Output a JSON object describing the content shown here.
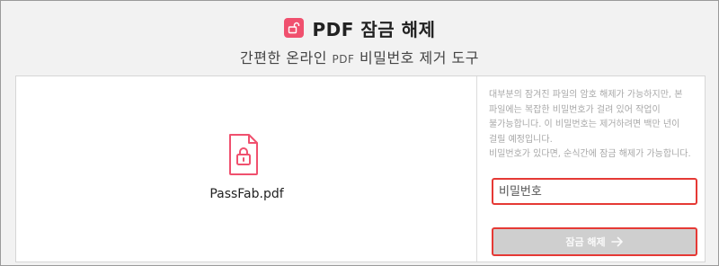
{
  "header": {
    "title": "PDF 잠금 해제",
    "subtitle_pre": "간편한 온라인",
    "subtitle_pdf": "PDF",
    "subtitle_post": "비밀번호 제거 도구"
  },
  "file": {
    "name": "PassFab.pdf"
  },
  "info": {
    "line1": "대부분의 잠겨진 파일의 암호 해제가 가능하지만, 본 파일에는 복잡한 비밀번호가 걸려 있어 작업이 불가능합니다. 이 비밀번호는 제거하려면 백만 년이 걸릴 예정입니다.",
    "line2": "비밀번호가 있다면, 순식간에 잠금 해제가 가능합니다."
  },
  "password": {
    "placeholder": "비밀번호"
  },
  "unlock_button": {
    "label": "잠금 해제"
  },
  "colors": {
    "accent": "#f0506e",
    "highlight": "#e53935",
    "button_bg": "#cfcfcf"
  },
  "icons": [
    "unlock-icon",
    "pdf-lock-file-icon",
    "arrow-right-icon"
  ]
}
